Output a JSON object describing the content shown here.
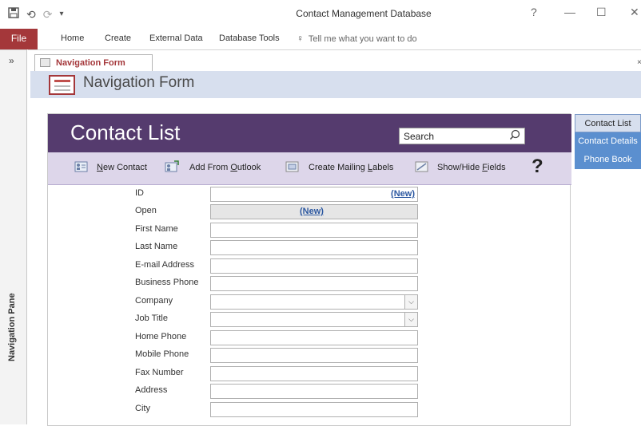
{
  "window": {
    "title": "Contact Management Database",
    "help_glyph": "?",
    "minimize_glyph": "—",
    "maximize_glyph": "☐",
    "close_glyph": "✕"
  },
  "quick_access": {
    "save_icon": "save-icon",
    "undo_icon": "undo-icon",
    "redo_icon": "redo-icon",
    "customize_icon": "customize-icon"
  },
  "ribbon": {
    "file": "File",
    "tabs": [
      "Home",
      "Create",
      "External Data",
      "Database Tools"
    ],
    "tell_me": "Tell me what you want to do"
  },
  "nav_pane": {
    "label": "Navigation Pane",
    "chevron": "»"
  },
  "doc_tab": {
    "label": "Navigation Form"
  },
  "form_header": {
    "title": "Navigation Form"
  },
  "contact_list": {
    "title": "Contact List",
    "search_placeholder": "Search",
    "toolbar": {
      "new_contact": "New Contact",
      "add_from_outlook": "Add From Outlook",
      "create_mailing_labels": "Create Mailing Labels",
      "show_hide_fields": "Show/Hide Fields",
      "help": "?"
    },
    "fields": [
      {
        "label": "ID",
        "value": "(New)",
        "type": "id"
      },
      {
        "label": "Open",
        "value": "(New)",
        "type": "open"
      },
      {
        "label": "First Name",
        "value": "",
        "type": "text"
      },
      {
        "label": "Last Name",
        "value": "",
        "type": "text"
      },
      {
        "label": "E-mail Address",
        "value": "",
        "type": "text"
      },
      {
        "label": "Business Phone",
        "value": "",
        "type": "text"
      },
      {
        "label": "Company",
        "value": "",
        "type": "combo"
      },
      {
        "label": "Job Title",
        "value": "",
        "type": "combo"
      },
      {
        "label": "Home Phone",
        "value": "",
        "type": "text"
      },
      {
        "label": "Mobile Phone",
        "value": "",
        "type": "text"
      },
      {
        "label": "Fax Number",
        "value": "",
        "type": "text"
      },
      {
        "label": "Address",
        "value": "",
        "type": "text"
      },
      {
        "label": "City",
        "value": "",
        "type": "text"
      }
    ]
  },
  "nav_buttons": [
    {
      "label": "Contact List",
      "active": true
    },
    {
      "label": "Contact Details",
      "active": false
    },
    {
      "label": "Phone Book",
      "active": false
    }
  ],
  "colors": {
    "file_tab": "#a4373a",
    "header_purple": "#553b6e",
    "toolbar_lavender": "#ddd6ea",
    "nav_blue": "#5b8fcf"
  }
}
